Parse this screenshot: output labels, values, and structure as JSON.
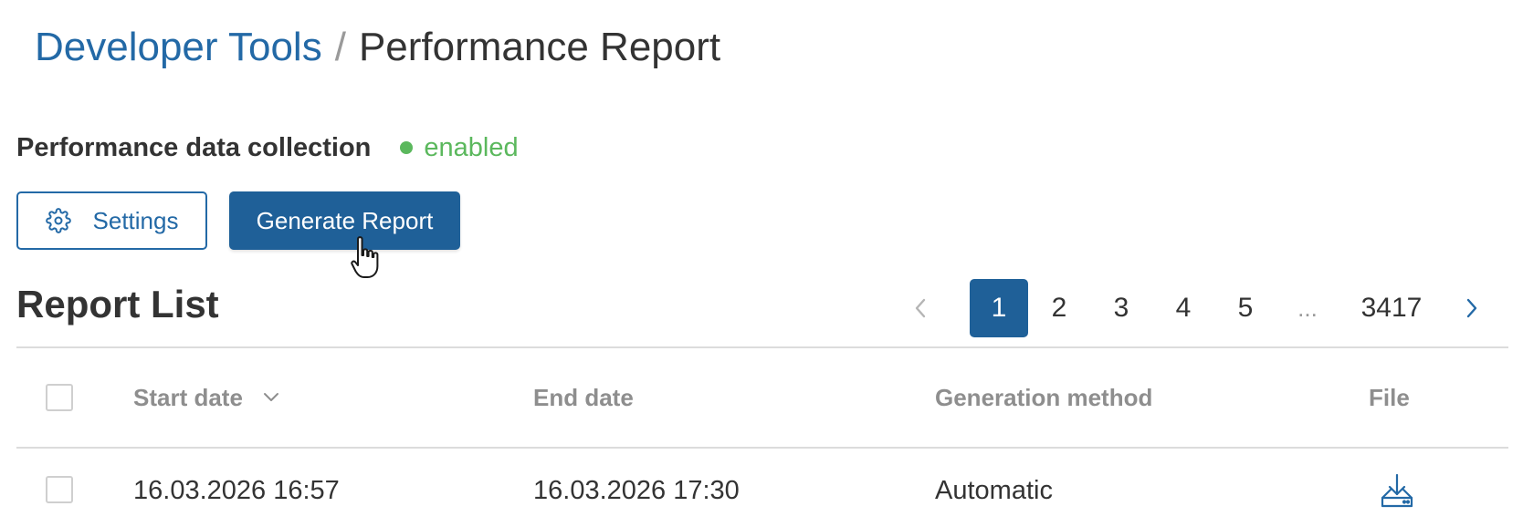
{
  "breadcrumb": {
    "parent": "Developer Tools",
    "separator": "/",
    "current": "Performance Report"
  },
  "collection": {
    "label": "Performance data collection",
    "status": "enabled",
    "status_color": "#5bb85d"
  },
  "actions": {
    "settings_label": "Settings",
    "generate_label": "Generate Report"
  },
  "report_list": {
    "title": "Report List",
    "pagination": {
      "pages": [
        "1",
        "2",
        "3",
        "4",
        "5"
      ],
      "active": "1",
      "ellipsis": "...",
      "last": "3417"
    },
    "columns": {
      "start": "Start date",
      "end": "End date",
      "method": "Generation method",
      "file": "File"
    },
    "rows": [
      {
        "start": "16.03.2026 16:57",
        "end": "16.03.2026 17:30",
        "method": "Automatic",
        "file_icon": "download-icon"
      }
    ]
  },
  "colors": {
    "accent": "#2369a6",
    "primary_button": "#1f6098",
    "success": "#5bb85d",
    "muted_text": "#8e8e8e"
  },
  "icons": {
    "settings": "gear-icon",
    "sort": "chevron-down-icon",
    "prev": "chevron-left-icon",
    "next": "chevron-right-icon",
    "download": "download-icon",
    "cursor": "hand-pointer-cursor"
  }
}
